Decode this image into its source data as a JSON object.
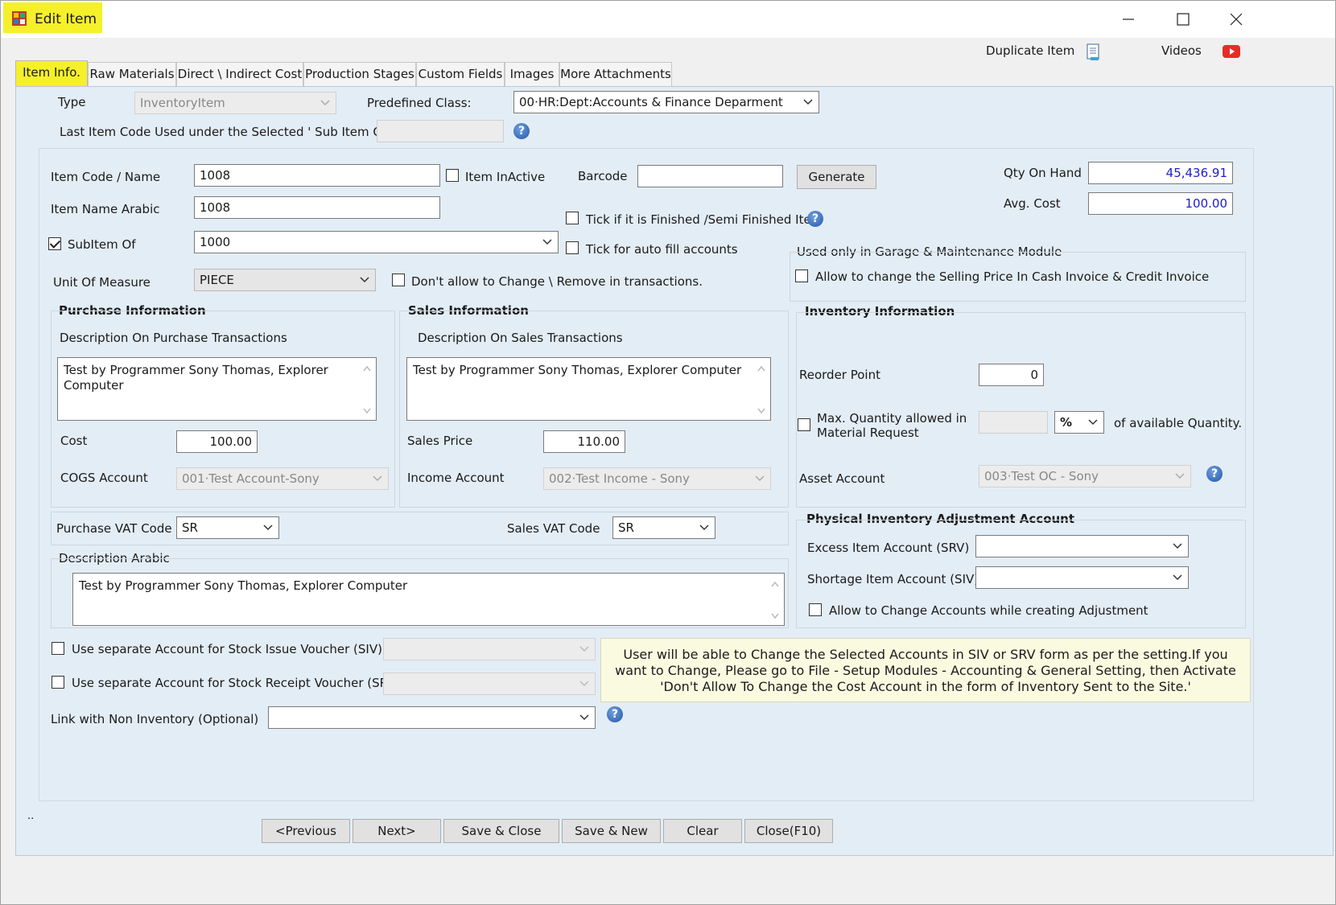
{
  "window": {
    "title": "Edit Item"
  },
  "toolbar": {
    "duplicate_label": "Duplicate Item",
    "videos_label": "Videos"
  },
  "tabs": [
    "Item Info.",
    "Raw Materials",
    "Direct \\ Indirect Cost",
    "Production Stages",
    "Custom Fields",
    "Images",
    "More Attachments"
  ],
  "header": {
    "type_label": "Type",
    "type_value": "InventoryItem",
    "predefined_label": "Predefined Class:",
    "predefined_value": "00·HR:Dept:Accounts & Finance Deparment",
    "last_code_label": "Last Item Code Used under the Selected ' Sub Item Of '",
    "last_code_value": ""
  },
  "item": {
    "code_label": "Item Code / Name",
    "code_value": "1008",
    "inactive_label": "Item InActive",
    "inactive_checked": false,
    "barcode_label": "Barcode",
    "barcode_value": "",
    "generate_label": "Generate",
    "qty_label": "Qty On Hand",
    "qty_value": "45,436.91",
    "avgcost_label": "Avg. Cost",
    "avgcost_value": "100.00",
    "name_arabic_label": "Item Name Arabic",
    "name_arabic_value": "1008",
    "finished_label": "Tick if it is Finished /Semi Finished Item",
    "finished_checked": false,
    "subitem_label": "SubItem Of",
    "subitem_checked": true,
    "subitem_value": "1000",
    "autofill_label": "Tick for auto fill accounts",
    "autofill_checked": false,
    "uom_label": "Unit Of Measure",
    "uom_value": "PIECE",
    "dont_allow_label": "Don't allow to Change \\ Remove in transactions.",
    "dont_allow_checked": false
  },
  "garage": {
    "title": "Used only in Garage & Maintenance Module",
    "allow_label": "Allow to change the Selling Price In Cash Invoice & Credit Invoice",
    "allow_checked": false
  },
  "purchase": {
    "title": "Purchase Information",
    "desc_label": "Description On  Purchase Transactions",
    "desc_value": "Test by Programmer Sony Thomas, Explorer Computer",
    "cost_label": "Cost",
    "cost_value": "100.00",
    "cogs_label": "COGS Account",
    "cogs_value": "001·Test Account-Sony"
  },
  "sales": {
    "title": "Sales Information",
    "desc_label": "Description On Sales Transactions",
    "desc_value": "Test by Programmer Sony Thomas, Explorer Computer",
    "price_label": "Sales Price",
    "price_value": "110.00",
    "income_label": "Income Account",
    "income_value": "002·Test Income - Sony"
  },
  "inventory": {
    "title": "Inventory Information",
    "reorder_label": "Reorder Point",
    "reorder_value": "0",
    "maxqty_label_1": "Max. Quantity allowed in",
    "maxqty_label_2": "Material Request",
    "maxqty_checked": false,
    "maxqty_value": "",
    "maxqty_unit": "%",
    "available_label": "of available Quantity.",
    "asset_label": "Asset Account",
    "asset_value": "003·Test OC - Sony"
  },
  "vat": {
    "purchase_label": "Purchase VAT Code",
    "purchase_value": "SR",
    "sales_label": "Sales VAT Code",
    "sales_value": "SR"
  },
  "desc_arabic": {
    "label": "Description Arabic",
    "value": "Test by Programmer Sony Thomas, Explorer Computer"
  },
  "physical": {
    "title": "Physical Inventory Adjustment Account",
    "excess_label": "Excess Item Account (SRV)",
    "excess_value": "",
    "shortage_label": "Shortage Item Account (SIV)",
    "shortage_value": "",
    "allow_label": "Allow to Change Accounts while creating Adjustment",
    "allow_checked": false
  },
  "separate": {
    "siv_label": "Use separate Account for Stock Issue Voucher (SIV)",
    "siv_checked": false,
    "srv_label": "Use separate Account for Stock Receipt Voucher (SRV)",
    "srv_checked": false,
    "link_label": "Link with Non Inventory (Optional)",
    "link_value": ""
  },
  "note": {
    "text": "User will be able to Change the Selected Accounts in SIV or SRV form as per the setting.If you want to Change, Please go to File - Setup Modules - Accounting & General Setting, then Activate 'Don't Allow To Change the Cost Account in the form of Inventory Sent to the Site.'"
  },
  "status": {
    "dots": ".."
  },
  "footer": {
    "previous": "<Previous",
    "next": "Next>",
    "save_close": "Save & Close",
    "save_new": "Save & New",
    "clear": "Clear",
    "close": "Close(F10)"
  },
  "colors": {
    "highlight": "#f5f02a",
    "panel": "#e3edf5",
    "qty_text": "#1c1ccf",
    "help_icon": "#2456a8",
    "note_bg": "#fafae0"
  }
}
